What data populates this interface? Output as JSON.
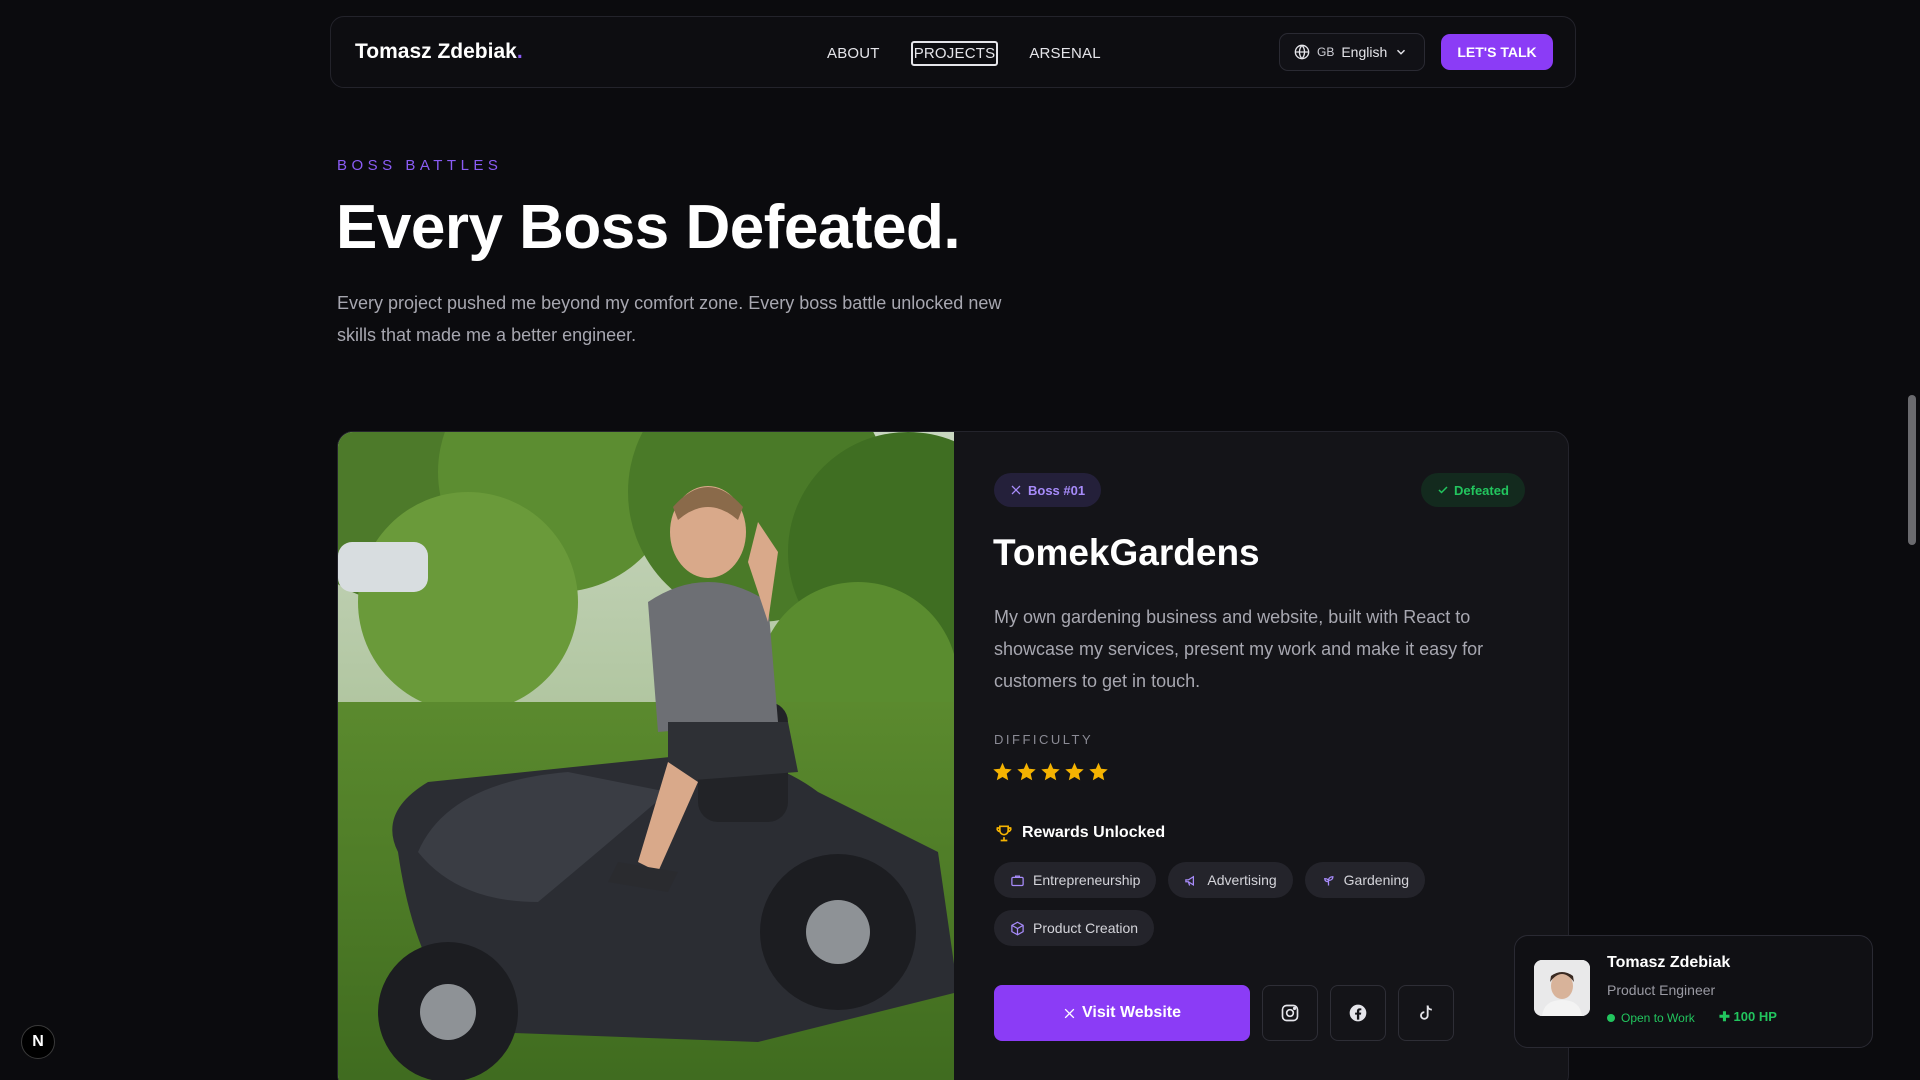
{
  "nav": {
    "brand": "Tomasz Zdebiak",
    "brand_dot": ".",
    "links": [
      "ABOUT",
      "PROJECTS",
      "ARSENAL"
    ],
    "active_link": "PROJECTS",
    "language_code": "GB",
    "language": "English",
    "cta": "LET'S TALK"
  },
  "hero": {
    "eyebrow": "BOSS BATTLES",
    "title": "Every Boss Defeated.",
    "subtitle": "Every project pushed me beyond my comfort zone. Every boss battle unlocked new skills that made me a better engineer."
  },
  "project": {
    "boss_label": "Boss #01",
    "status": "Defeated",
    "title": "TomekGardens",
    "description": "My own gardening business and website, built with React to showcase my services, present my work and make it easy for customers to get in touch.",
    "difficulty_label": "DIFFICULTY",
    "difficulty_stars": 5,
    "difficulty_max": 5,
    "rewards_label": "Rewards Unlocked",
    "rewards": [
      {
        "label": "Entrepreneurship",
        "icon": "briefcase-icon"
      },
      {
        "label": "Advertising",
        "icon": "megaphone-icon"
      },
      {
        "label": "Gardening",
        "icon": "sprout-icon"
      },
      {
        "label": "Product Creation",
        "icon": "box-icon"
      }
    ],
    "visit_label": "Visit Website",
    "socials": [
      "instagram-icon",
      "facebook-icon",
      "tiktok-icon"
    ]
  },
  "profile": {
    "name": "Tomasz Zdebiak",
    "role": "Product Engineer",
    "status": "Open to Work",
    "hp": "100 HP"
  },
  "next_badge": "N",
  "colors": {
    "accent": "#8b3cf6",
    "accent_text": "#8b5cf6",
    "success": "#22c55e",
    "star": "#f5b301",
    "background": "#0b0b0e"
  }
}
